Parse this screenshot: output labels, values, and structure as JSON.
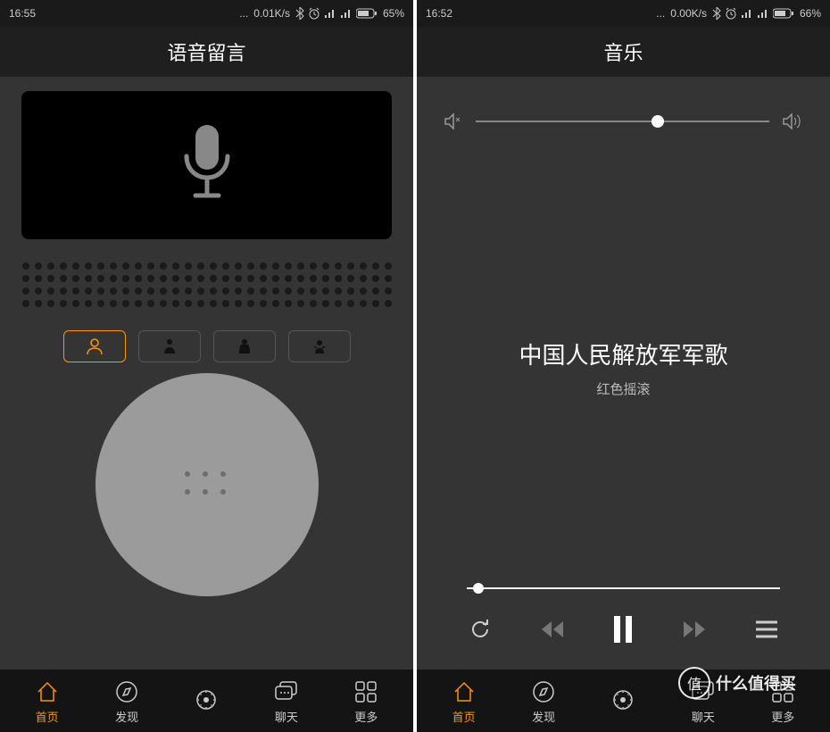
{
  "left": {
    "status": {
      "time": "16:55",
      "net_speed": "0.01K/s",
      "battery": "65%"
    },
    "header_title": "语音留言",
    "nav": [
      {
        "label": "首页",
        "active": true
      },
      {
        "label": "发现",
        "active": false
      },
      {
        "label": "",
        "active": false
      },
      {
        "label": "聊天",
        "active": false
      },
      {
        "label": "更多",
        "active": false
      }
    ]
  },
  "right": {
    "status": {
      "time": "16:52",
      "net_speed": "0.00K/s",
      "battery": "66%"
    },
    "header_title": "音乐",
    "volume_percent": 60,
    "song": {
      "title": "中国人民解放军军歌",
      "artist": "红色摇滚"
    },
    "progress_percent": 2,
    "nav": [
      {
        "label": "首页",
        "active": true
      },
      {
        "label": "发现",
        "active": false
      },
      {
        "label": "",
        "active": false
      },
      {
        "label": "聊天",
        "active": false
      },
      {
        "label": "更多",
        "active": false
      }
    ]
  },
  "watermark": {
    "badge": "值",
    "text": "什么值得买"
  }
}
